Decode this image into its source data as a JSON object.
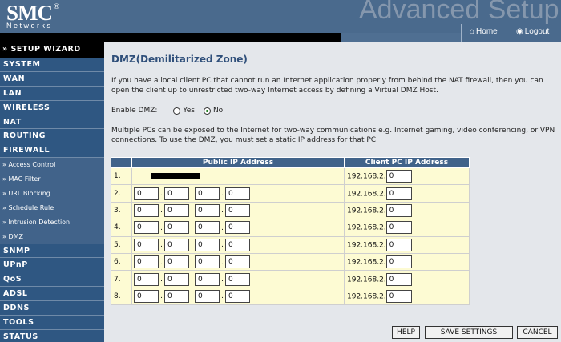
{
  "header": {
    "logo_text": "SMC",
    "logo_mark": "®",
    "logo_sub": "Networks",
    "banner_text": "Advanced Setup",
    "home_label": "Home",
    "logout_label": "Logout",
    "home_icon": "home-icon",
    "logout_icon": "logout-icon"
  },
  "sidebar": {
    "wizard_label": "» SETUP WIZARD",
    "items_top": [
      "SYSTEM",
      "WAN",
      "LAN",
      "WIRELESS",
      "NAT",
      "ROUTING",
      "FIREWALL"
    ],
    "firewall_sub": [
      "» Access Control",
      "» MAC Filter",
      "» URL Blocking",
      "» Schedule Rule",
      "» Intrusion Detection",
      "» DMZ"
    ],
    "items_bottom": [
      "SNMP",
      "UPnP",
      "QoS",
      "ADSL",
      "DDNS",
      "TOOLS",
      "STATUS"
    ]
  },
  "page": {
    "title": "DMZ(Demilitarized Zone)",
    "intro": "If you have a local client PC that cannot run an Internet application properly from behind the NAT firewall, then you can open the client up to unrestricted two-way Internet access by defining a Virtual DMZ Host.",
    "enable_label": "Enable DMZ:",
    "yes_label": "Yes",
    "no_label": "No",
    "enable_selected": "No",
    "multi_text": "Multiple PCs can be exposed to the Internet for two-way communications e.g. Internet gaming, video conferencing, or VPN connections.  To use the DMZ, you must set a static IP address for that PC."
  },
  "table": {
    "col_public": "Public IP Address",
    "col_client": "Client PC IP Address",
    "client_prefix": "192.168.2.",
    "rows": [
      {
        "num": "1.",
        "public": null,
        "client": "0"
      },
      {
        "num": "2.",
        "public": [
          "0",
          "0",
          "0",
          "0"
        ],
        "client": "0"
      },
      {
        "num": "3.",
        "public": [
          "0",
          "0",
          "0",
          "0"
        ],
        "client": "0"
      },
      {
        "num": "4.",
        "public": [
          "0",
          "0",
          "0",
          "0"
        ],
        "client": "0"
      },
      {
        "num": "5.",
        "public": [
          "0",
          "0",
          "0",
          "0"
        ],
        "client": "0"
      },
      {
        "num": "6.",
        "public": [
          "0",
          "0",
          "0",
          "0"
        ],
        "client": "0"
      },
      {
        "num": "7.",
        "public": [
          "0",
          "0",
          "0",
          "0"
        ],
        "client": "0"
      },
      {
        "num": "8.",
        "public": [
          "0",
          "0",
          "0",
          "0"
        ],
        "client": "0"
      }
    ],
    "ip_separator": "."
  },
  "buttons": {
    "help": "HELP",
    "save": "SAVE SETTINGS",
    "cancel": "CANCEL"
  },
  "colors": {
    "header_bg": "#4a6a8d",
    "sidebar_item_bg": "#2f5782",
    "table_header_bg": "#41638a",
    "table_row_bg": "#fdfbd3",
    "title_color": "#2f4f7a"
  }
}
